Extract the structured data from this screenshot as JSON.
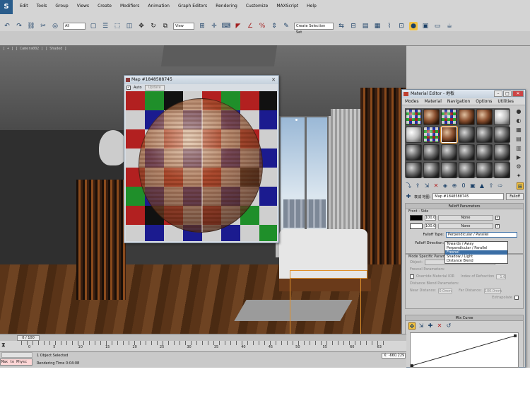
{
  "app": {
    "logo": "S",
    "menu": [
      "Edit",
      "Tools",
      "Group",
      "Views",
      "Create",
      "Modifiers",
      "Animation",
      "Graph Editors",
      "Rendering",
      "Customize",
      "MAXScript",
      "Help"
    ],
    "filter_select": "All",
    "view_select": "View",
    "selection_set": "Create Selection Set"
  },
  "viewport": {
    "label": "[ + ] [ Camera002 ] [ Shaded ]"
  },
  "map_window": {
    "title": "Map #1848588745",
    "auto_label": "Auto",
    "update_label": "Update"
  },
  "material_editor": {
    "title": "Material Editor - 地板",
    "menu": [
      "Modes",
      "Material",
      "Navigation",
      "Options",
      "Utilities"
    ],
    "map_label": "衰减 地图:",
    "map_name": "Map #1848588745",
    "map_type": "Falloff",
    "falloff_params_title": "Falloff Parameters",
    "front_side": "Front : Side",
    "row1_value": "100.0",
    "row1_map": "None",
    "row2_value": "100.0",
    "row2_map": "None",
    "falloff_type_label": "Falloff Type:",
    "falloff_type_value": "Perpendicular / Parallel",
    "falloff_direction_label": "Falloff Direction:",
    "dropdown_options": [
      "Towards / Away",
      "Perpendicular / Parallel",
      "Fresnel",
      "Shadow / Light",
      "Distance Blend"
    ],
    "dropdown_selected_index": 2,
    "mode_specific": "Mode Specific Parameters",
    "object_label": "Object:",
    "object_value": "None",
    "fresnel_params": "Fresnel Parameters:",
    "override_ior": "Override Material IOR",
    "ior_label": "Index of Refraction",
    "ior_value": "1.6",
    "distance_blend": "Distance Blend Parameters:",
    "near_distance_label": "Near Distance:",
    "near_distance_value": "0.0mm",
    "far_distance_label": "Far Distance:",
    "far_distance_value": "100.0mm",
    "extrapolate": "Extrapolate",
    "mix_curve": "Mix Curve"
  },
  "timeline": {
    "slider": "0 / 100",
    "ticks": [
      "0",
      "5",
      "10",
      "15",
      "20",
      "25",
      "30",
      "35",
      "40",
      "45",
      "50",
      "55",
      "60",
      "63"
    ]
  },
  "status": {
    "maxscript": "Max to Physc",
    "selection": "1 Object Selected",
    "rendering": "Rendering Time 0:04:08",
    "coord": "X: -660.229"
  }
}
